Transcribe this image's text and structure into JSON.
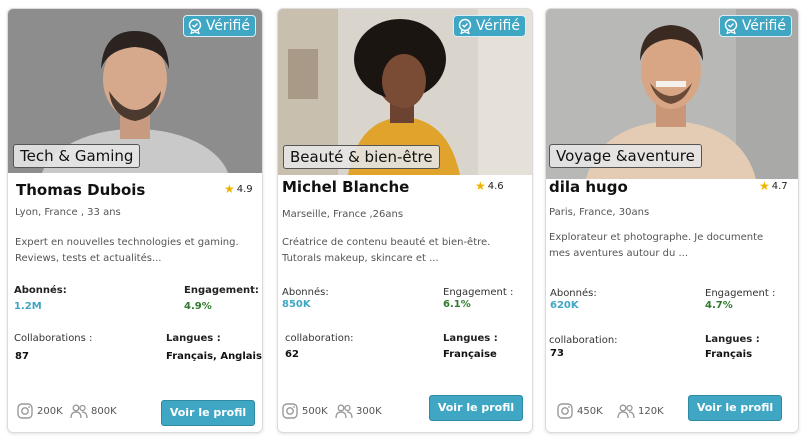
{
  "badge_label": "Vérifié",
  "colors": {
    "accent": "#3fa6c4",
    "engagement_green": "#2f7a2c",
    "star": "#f0b400"
  },
  "cards": [
    {
      "category": "Tech & Gaming",
      "name": "Thomas Dubois",
      "rating": "4.9",
      "location": "Lyon, France , 33 ans",
      "description": "Expert en nouvelles technologies et gaming. Reviews, tests et actualités...",
      "followers_label": "Abonnés:",
      "followers_value": "1.2M",
      "engagement_label": "Engagement:",
      "engagement_value": "4.9%",
      "collab_label": "Collaborations :",
      "collab_value": "87",
      "langs_label": "Langues :",
      "langs_value": "Français, Anglais",
      "instagram": "200K",
      "community": "800K",
      "button_label": "Voir le profil"
    },
    {
      "category": "Beauté & bien-être",
      "name": "Michel Blanche",
      "rating": "4.6",
      "location": "Marseille, France ,26ans",
      "description": "Créatrice de contenu beauté et bien-être. Tutorals makeup, skincare et ...",
      "followers_label": "Abonnés:",
      "followers_value": "850K",
      "engagement_label": "Engagement :",
      "engagement_value": "6.1%",
      "collab_label": "collaboration:",
      "collab_value": "62",
      "langs_label": "Langues :",
      "langs_value": "Française",
      "instagram": "500K",
      "community": "300K",
      "button_label": "Voir le profil"
    },
    {
      "category": "Voyage &aventure",
      "name": "dila hugo",
      "rating": "4.7",
      "location": "Paris, France, 30ans",
      "description": "Explorateur et photographe. Je documente mes aventures autour du ...",
      "followers_label": "Abonnés:",
      "followers_value": "620K",
      "engagement_label": "Engagement :",
      "engagement_value": "4.7%",
      "collab_label": "collaboration:",
      "collab_value": "73",
      "langs_label": "Langues :",
      "langs_value": "Français",
      "instagram": "450K",
      "community": "120K",
      "button_label": "Voir le profil"
    }
  ]
}
